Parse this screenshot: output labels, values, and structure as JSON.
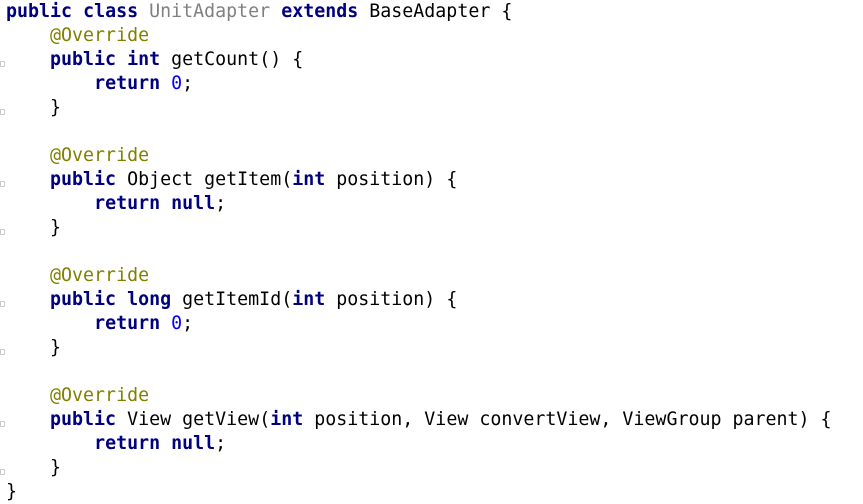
{
  "editor": {
    "class_decl": {
      "kw_public": "public",
      "kw_class": "class",
      "class_name": "UnitAdapter",
      "kw_extends": "extends",
      "base": "BaseAdapter",
      "open": " {"
    },
    "methods": [
      {
        "annotation": "@Override",
        "kw_public": "public",
        "return_type": "int",
        "return_type_is_keyword": true,
        "name": "getCount",
        "params": "()",
        "open": " {",
        "kw_return": "return",
        "return_value": "0",
        "return_value_kind": "number",
        "close": "}"
      },
      {
        "annotation": "@Override",
        "kw_public": "public",
        "return_type": "Object",
        "return_type_is_keyword": false,
        "name": "getItem",
        "param_kw": "int",
        "param_rest": " position)",
        "open": " {",
        "kw_return": "return",
        "return_value": "null",
        "return_value_kind": "keyword",
        "close": "}"
      },
      {
        "annotation": "@Override",
        "kw_public": "public",
        "return_type": "long",
        "return_type_is_keyword": true,
        "name": "getItemId",
        "param_kw": "int",
        "param_rest": " position)",
        "open": " {",
        "kw_return": "return",
        "return_value": "0",
        "return_value_kind": "number",
        "close": "}"
      },
      {
        "annotation": "@Override",
        "kw_public": "public",
        "return_type": "View",
        "return_type_is_keyword": false,
        "name": "getView",
        "param_kw": "int",
        "param_rest": " position, View convertView, ViewGroup parent)",
        "open": " {",
        "kw_return": "return",
        "return_value": "null",
        "return_value_kind": "keyword",
        "close": "}"
      }
    ],
    "class_close": "}",
    "colors": {
      "keyword": "#000080",
      "number": "#0000ff",
      "annotation": "#808000",
      "unused_class_name": "#808080",
      "text": "#000000",
      "background": "#ffffff"
    }
  }
}
